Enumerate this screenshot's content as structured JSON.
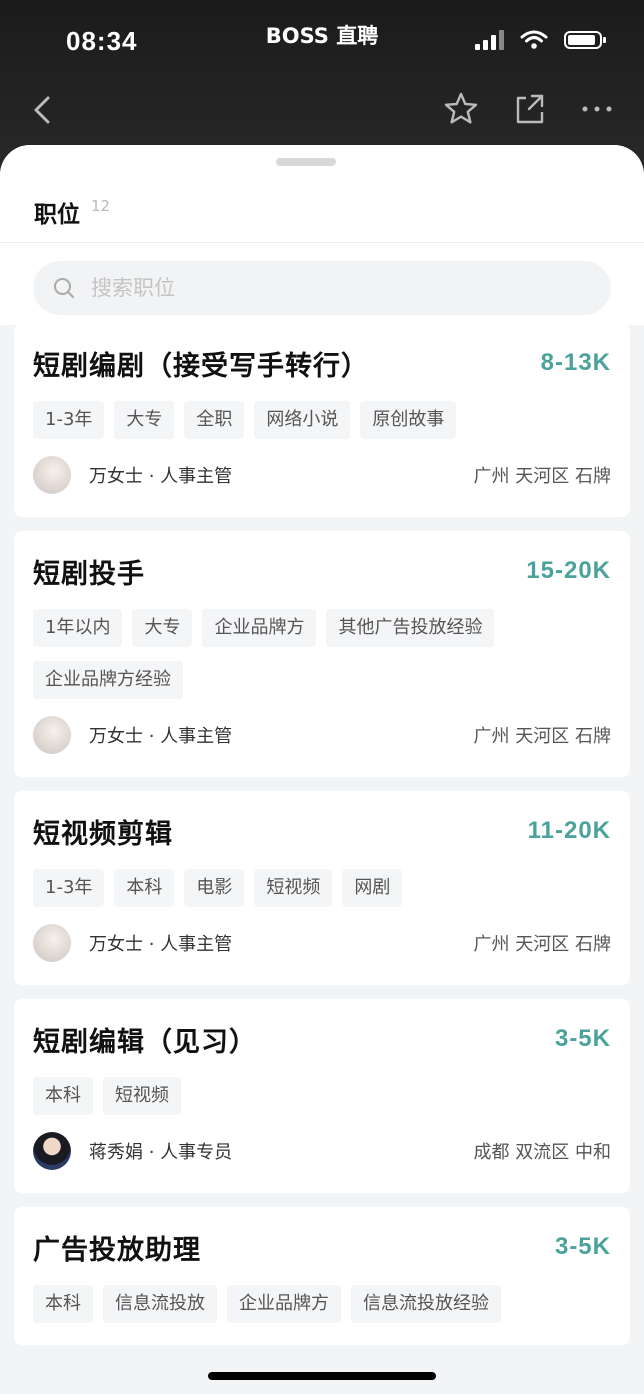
{
  "status_bar": {
    "time": "08:34",
    "app_name": "BOSS 直聘"
  },
  "nav": {
    "back_icon": "chevron-left-icon",
    "icons": [
      "star-icon",
      "share-icon",
      "more-icon"
    ]
  },
  "tab": {
    "title": "职位",
    "count": "12"
  },
  "search": {
    "placeholder": "搜索职位",
    "value": ""
  },
  "colors": {
    "salary": "#4aa39b",
    "tag_bg": "#f4f5f7",
    "page_bg": "#f3f4f6"
  },
  "jobs": [
    {
      "title": "短剧编剧（接受写手转行）",
      "salary": "8-13K",
      "tags": [
        "1-3年",
        "大专",
        "全职",
        "网络小说",
        "原创故事"
      ],
      "recruiter": "万女士 · 人事主管",
      "location": "广州 天河区 石牌"
    },
    {
      "title": "短剧投手",
      "salary": "15-20K",
      "tags": [
        "1年以内",
        "大专",
        "企业品牌方",
        "其他广告投放经验",
        "企业品牌方经验"
      ],
      "recruiter": "万女士 · 人事主管",
      "location": "广州 天河区 石牌"
    },
    {
      "title": "短视频剪辑",
      "salary": "11-20K",
      "tags": [
        "1-3年",
        "本科",
        "电影",
        "短视频",
        "网剧"
      ],
      "recruiter": "万女士 · 人事主管",
      "location": "广州 天河区 石牌"
    },
    {
      "title": "短剧编辑（见习）",
      "salary": "3-5K",
      "tags": [
        "本科",
        "短视频"
      ],
      "recruiter": "蒋秀娟 · 人事专员",
      "location": "成都 双流区 中和"
    },
    {
      "title": "广告投放助理",
      "salary": "3-5K",
      "tags": [
        "本科",
        "信息流投放",
        "企业品牌方",
        "信息流投放经验"
      ],
      "recruiter": "",
      "location": ""
    }
  ]
}
